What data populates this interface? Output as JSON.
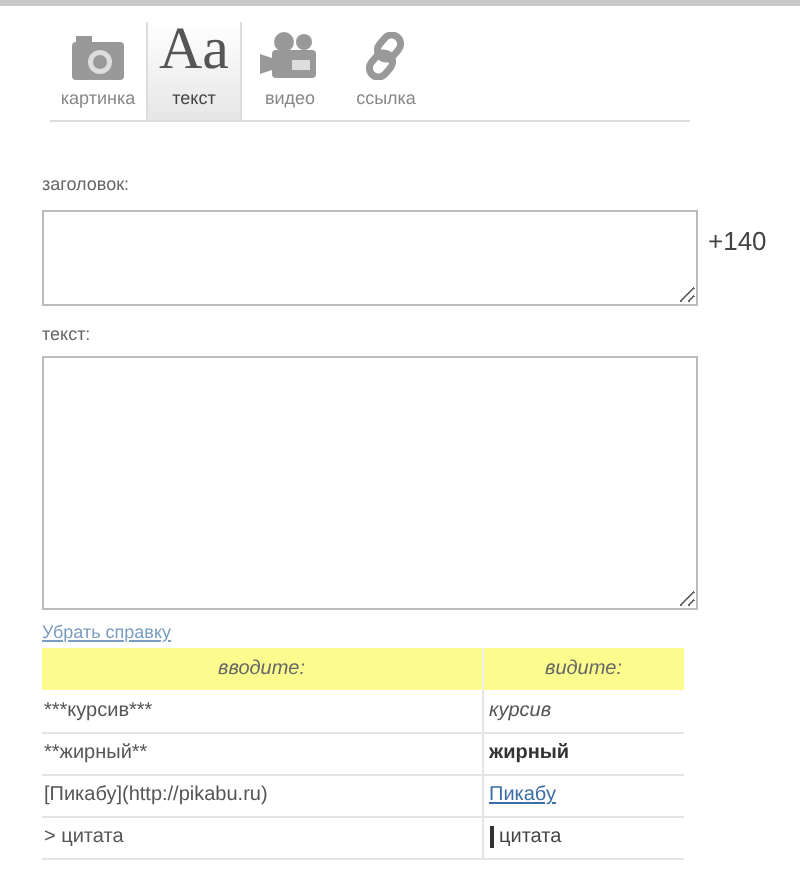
{
  "tabs": [
    {
      "label": "картинка",
      "kind": "camera",
      "selected": false
    },
    {
      "label": "текст",
      "kind": "text",
      "icon_text": "Aa",
      "selected": true
    },
    {
      "label": "видео",
      "kind": "video",
      "selected": false
    },
    {
      "label": "ссылка",
      "kind": "link",
      "selected": false
    }
  ],
  "title_field": {
    "label": "заголовок:",
    "counter": "+140"
  },
  "text_field": {
    "label": "текст:"
  },
  "help_link": "Убрать справку",
  "help_table": {
    "columns": [
      "вводите:",
      "видите:"
    ],
    "rows": [
      {
        "input": "***курсив***",
        "result": "курсив",
        "kind": "italic"
      },
      {
        "input": "**жирный**",
        "result": "жирный",
        "kind": "bold"
      },
      {
        "input": "[Пикабу](http://pikabu.ru)",
        "result": "Пикабу",
        "kind": "link"
      },
      {
        "input": "> цитата",
        "result": "цитата",
        "kind": "quote"
      }
    ]
  }
}
